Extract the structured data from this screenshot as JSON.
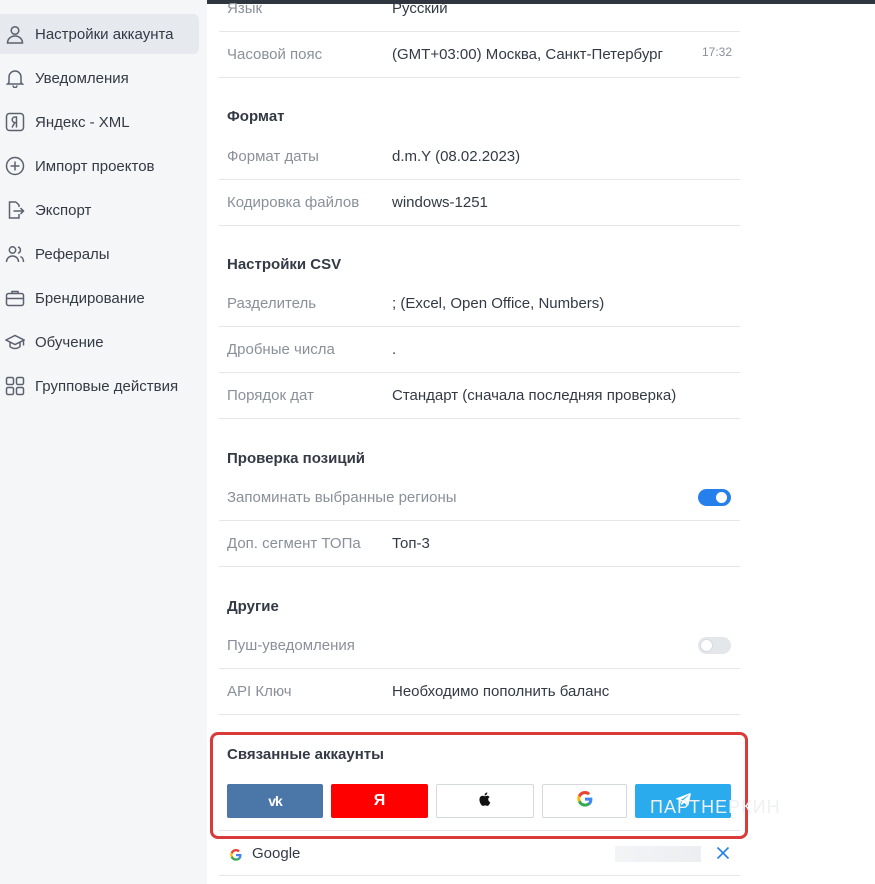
{
  "sidebar": {
    "items": [
      {
        "label": "Настройки аккаунта",
        "icon": "user-icon",
        "active": true
      },
      {
        "label": "Уведомления",
        "icon": "bell-icon"
      },
      {
        "label": "Яндекс - XML",
        "icon": "yandex-icon"
      },
      {
        "label": "Импорт проектов",
        "icon": "plus-circle-icon"
      },
      {
        "label": "Экспорт",
        "icon": "export-icon"
      },
      {
        "label": "Рефералы",
        "icon": "users-icon"
      },
      {
        "label": "Брендирование",
        "icon": "briefcase-icon"
      },
      {
        "label": "Обучение",
        "icon": "graduation-cap-icon"
      },
      {
        "label": "Групповые действия",
        "icon": "grid-icon"
      }
    ]
  },
  "settings": {
    "language": {
      "label": "Язык",
      "value": "Русский"
    },
    "timezone": {
      "label": "Часовой пояс",
      "value": "(GMT+03:00) Москва, Санкт-Петербург",
      "time": "17:32"
    },
    "format": {
      "title": "Формат",
      "date_format": {
        "label": "Формат даты",
        "value": "d.m.Y (08.02.2023)"
      },
      "encoding": {
        "label": "Кодировка файлов",
        "value": "windows-1251"
      }
    },
    "csv": {
      "title": "Настройки CSV",
      "separator": {
        "label": "Разделитель",
        "value": "; (Excel, Open Office, Numbers)"
      },
      "decimals": {
        "label": "Дробные числа",
        "value": "."
      },
      "date_order": {
        "label": "Порядок дат",
        "value": "Стандарт (сначала последняя проверка)"
      }
    },
    "positions": {
      "title": "Проверка позиций",
      "remember_regions": {
        "label": "Запоминать выбранные регионы",
        "enabled": true
      },
      "top_segment": {
        "label": "Доп. сегмент ТОПа",
        "value": "Топ-3"
      }
    },
    "other": {
      "title": "Другие",
      "push": {
        "label": "Пуш-уведомления",
        "enabled": false
      },
      "api_key": {
        "label": "API Ключ",
        "value": "Необходимо пополнить баланс"
      }
    },
    "linked": {
      "title": "Связанные аккаунты",
      "buttons": [
        {
          "name": "vk",
          "text": "vk",
          "color": "#4a76a8"
        },
        {
          "name": "yandex",
          "text": "Я",
          "color": "#ff0000"
        },
        {
          "name": "apple",
          "color": "#ffffff"
        },
        {
          "name": "google",
          "color": "#ffffff"
        },
        {
          "name": "telegram",
          "color": "#2aabee"
        }
      ],
      "accounts": [
        {
          "provider": "Google"
        }
      ]
    }
  },
  "watermark": "ПАРТНЕРКИН",
  "colors": {
    "accent": "#2680eb",
    "highlight_border": "#d93a3a"
  }
}
